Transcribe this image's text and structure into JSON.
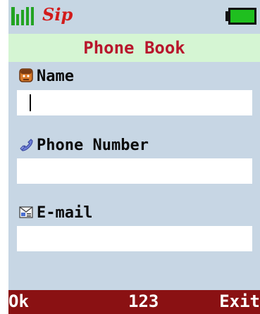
{
  "status": {
    "carrier": "Sip",
    "icons": [
      "signal-bars-icon",
      "battery-icon"
    ]
  },
  "header": {
    "title": "Phone Book"
  },
  "form": {
    "name_label": "Name",
    "name_icon": "contact-face-icon",
    "name_value": "",
    "phone_label": "Phone Number",
    "phone_icon": "phone-handset-icon",
    "phone_value": "",
    "email_label": "E-mail",
    "email_icon": "email-card-icon",
    "email_value": ""
  },
  "softkeys": {
    "left": "Ok",
    "middle": "123",
    "right": "Exit"
  },
  "colors": {
    "background": "#c7d6e4",
    "title_bar": "#d5f5d3",
    "title_text": "#b8162c",
    "softkey_bar": "#8a1113",
    "accent_green": "#2fa82f"
  }
}
